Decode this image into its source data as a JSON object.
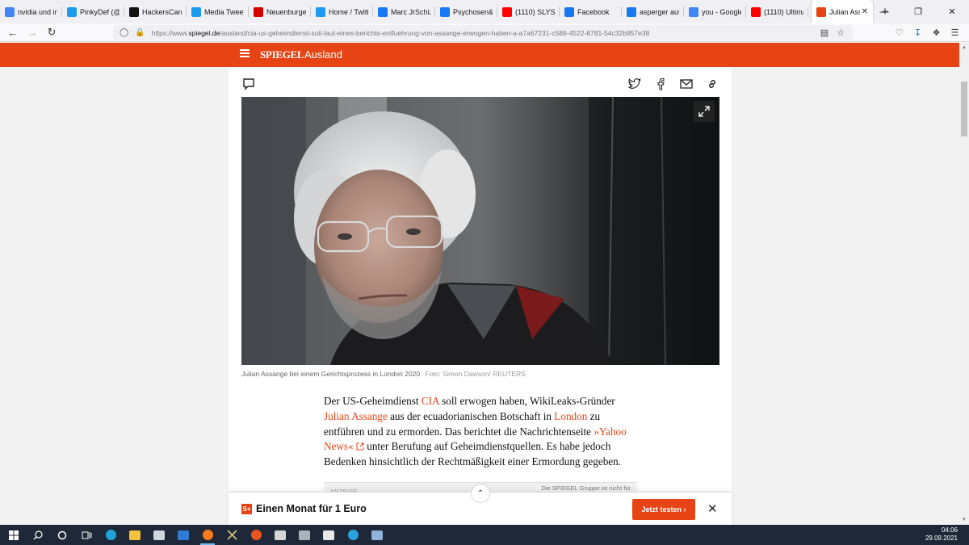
{
  "browser": {
    "tabs": [
      {
        "label": "nvidia und inte",
        "icon": "google-icon",
        "color": "#4285f4"
      },
      {
        "label": "PinkyDef (@Pi",
        "icon": "twitter-icon",
        "color": "#1d9bf0"
      },
      {
        "label": "HackersCardg",
        "icon": "github-icon",
        "color": "#111111"
      },
      {
        "label": "Media Tweets I",
        "icon": "twitter-icon",
        "color": "#1d9bf0"
      },
      {
        "label": "Neuenburgerst",
        "icon": "zeit-icon",
        "color": "#d40000"
      },
      {
        "label": "Home / Twitter",
        "icon": "twitter-icon",
        "color": "#1d9bf0"
      },
      {
        "label": "Marc JrSchizo",
        "icon": "facebook-icon",
        "color": "#1877f2"
      },
      {
        "label": "Psychosen&Sc",
        "icon": "facebook-icon",
        "color": "#1877f2"
      },
      {
        "label": "(1110) SLYSER",
        "icon": "youtube-icon",
        "color": "#ff0000"
      },
      {
        "label": "Facebook",
        "icon": "facebook-icon",
        "color": "#1877f2"
      },
      {
        "label": "asperger autist",
        "icon": "facebook-icon",
        "color": "#1877f2"
      },
      {
        "label": "you - Google S",
        "icon": "google-icon",
        "color": "#4285f4"
      },
      {
        "label": "(1110) Ultimat",
        "icon": "youtube-icon",
        "color": "#ff0000"
      }
    ],
    "active_tab": {
      "label": "Julian Assan",
      "icon": "spiegel-icon",
      "color": "#e64415"
    },
    "url_prefix": "https://www.",
    "url_domain": "spiegel.de",
    "url_path": "/ausland/cia-us-geheimdienst-soll-laut-eines-berichts-entfuehrung-von-assange-erwogen-haben-a-a7a67231-c588-4522-8781-54c32b957e38"
  },
  "site": {
    "brand": "SPIEGEL",
    "section": "Ausland",
    "accent": "#e64415"
  },
  "article": {
    "caption": "Julian Assange bei einem Gerichtsprozess in London 2020",
    "credit": "Foto: Simon Dawson/ REUTERS",
    "body": {
      "t1": "Der US-Geheimdienst ",
      "l1": "CIA",
      "t2": " soll erwogen haben, WikiLeaks-Gründer ",
      "l2": "Julian Assange",
      "t3": " aus der ecuadorianischen Botschaft in ",
      "l3": "London",
      "t4": " zu entführen und zu ermorden. Das berichtet die Nachrichtenseite ",
      "l4": "»Yahoo News«",
      "t5": " unter Berufung auf Geheimdienstquellen. Es habe jedoch Bedenken hinsichtlich der Rechtmäßigkeit einer Ermordung gegeben."
    },
    "ad_label": "ANZEIGE",
    "ad_note": "Die SPIEGEL Gruppe ist nicht für"
  },
  "promo": {
    "badge": "S+",
    "title": "Einen Monat für 1 Euro",
    "cta": "Jetzt testen ›"
  },
  "taskbar": {
    "time": "04:06",
    "date": "29.09.2021"
  }
}
